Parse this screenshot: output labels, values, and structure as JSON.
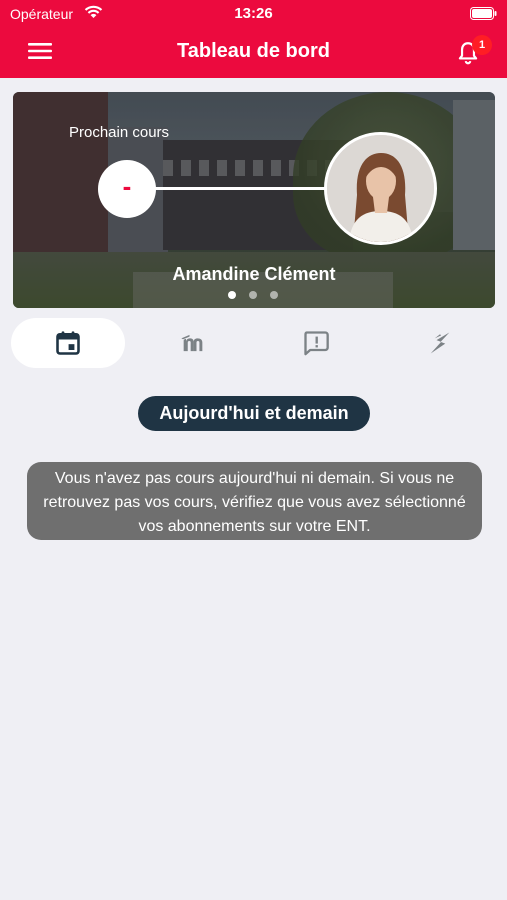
{
  "status_bar": {
    "carrier": "Opérateur",
    "time": "13:26"
  },
  "header": {
    "title": "Tableau de bord",
    "notification_count": "1",
    "icons": [
      "menu-icon",
      "bell-icon"
    ]
  },
  "next_course": {
    "label": "Prochain cours",
    "indicator": "-",
    "teacher_name": "Amandine Clément",
    "carousel_pages": 3,
    "carousel_active_page": 1
  },
  "tabs": [
    {
      "icon": "calendar-icon",
      "active": true
    },
    {
      "icon": "moodle-icon",
      "active": false
    },
    {
      "icon": "message-alert-icon",
      "active": false
    },
    {
      "icon": "lightning-icon",
      "active": false
    }
  ],
  "main": {
    "section_title": "Aujourd'hui et demain",
    "empty_message": "Vous n'avez pas cours aujourd'hui ni demain. Si vous ne retrouvez pas vos cours, vérifiez que vous avez sélectionné vos abonnements sur votre ENT."
  },
  "colors": {
    "brand_red": "#ec0a3e",
    "dark_navy": "#1f3444",
    "notice_gray": "#6f6f6f",
    "background": "#efeff4"
  }
}
